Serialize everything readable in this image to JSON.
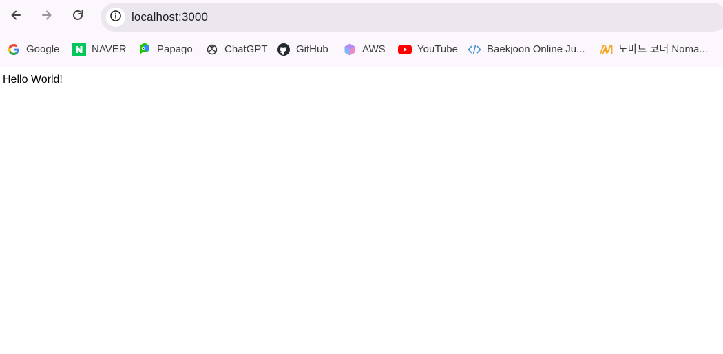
{
  "toolbar": {
    "back_icon": "arrow-left-icon",
    "forward_icon": "arrow-right-icon",
    "reload_icon": "reload-icon",
    "site_info_icon": "info-icon",
    "url": "localhost:3000"
  },
  "bookmarks": [
    {
      "label": "Google",
      "icon": "google-icon"
    },
    {
      "label": "NAVER",
      "icon": "naver-icon"
    },
    {
      "label": "Papago",
      "icon": "papago-icon"
    },
    {
      "label": "ChatGPT",
      "icon": "chatgpt-icon"
    },
    {
      "label": "GitHub",
      "icon": "github-icon"
    },
    {
      "label": "AWS",
      "icon": "aws-icon"
    },
    {
      "label": "YouTube",
      "icon": "youtube-icon"
    },
    {
      "label": "Baekjoon Online Ju...",
      "icon": "code-icon"
    },
    {
      "label": "노마드 코더 Noma...",
      "icon": "nomad-coders-icon"
    }
  ],
  "page": {
    "body_text": "Hello World!"
  },
  "colors": {
    "chrome_bg": "#fcf7fd",
    "omnibox_bg": "#ece6ee",
    "naver_green": "#03c75a",
    "youtube_red": "#ff0000",
    "nomad_orange": "#f5a623"
  }
}
